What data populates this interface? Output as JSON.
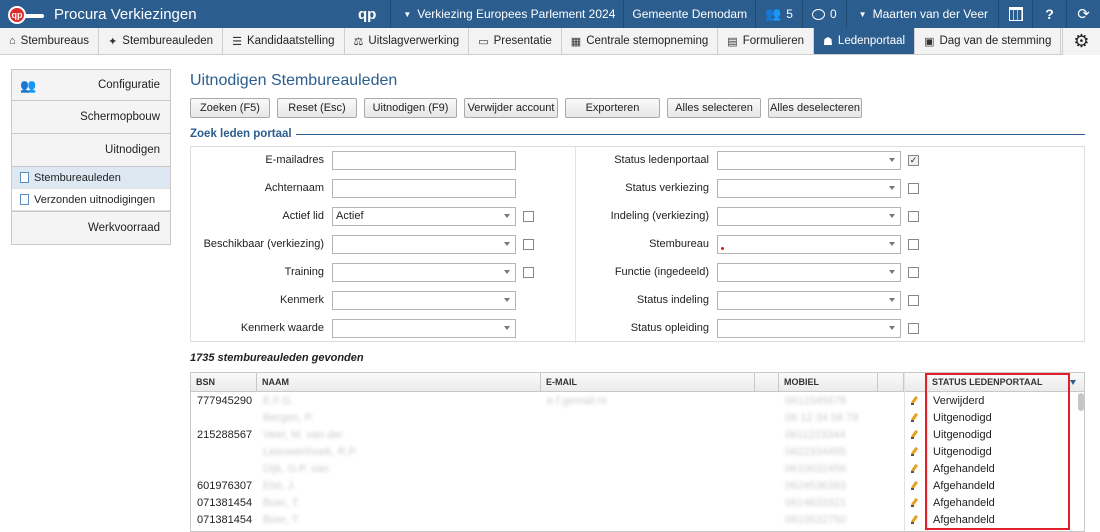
{
  "app": {
    "title": "Procura Verkiezingen",
    "logo_text": "qp",
    "brand_mark": "qp"
  },
  "topbar": {
    "election": "Verkiezing Europees Parlement 2024",
    "municipality": "Gemeente Demodam",
    "users_count": "5",
    "messages_count": "0",
    "user_name": "Maarten van der Veer",
    "help_label": "?"
  },
  "nav": {
    "tabs": [
      {
        "label": "Stembureaus",
        "icon": "home-icon"
      },
      {
        "label": "Stembureauleden",
        "icon": "people-icon"
      },
      {
        "label": "Kandidaatstelling",
        "icon": "list-icon"
      },
      {
        "label": "Uitslagverwerking",
        "icon": "scale-icon"
      },
      {
        "label": "Presentatie",
        "icon": "monitor-icon"
      },
      {
        "label": "Centrale stemopneming",
        "icon": "calculator-icon"
      },
      {
        "label": "Formulieren",
        "icon": "form-icon"
      },
      {
        "label": "Ledenportaal",
        "icon": "group-icon"
      },
      {
        "label": "Dag van de stemming",
        "icon": "ballot-icon"
      }
    ]
  },
  "sidebar": {
    "configuratie": "Configuratie",
    "schermopbouw": "Schermopbouw",
    "uitnodigen": "Uitnodigen",
    "sub_stembureauleden": "Stembureauleden",
    "sub_verzonden": "Verzonden uitnodigingen",
    "werkvoorraad": "Werkvoorraad"
  },
  "main": {
    "title": "Uitnodigen Stembureauleden",
    "buttons": {
      "zoeken": "Zoeken (F5)",
      "reset": "Reset (Esc)",
      "uitnodigen": "Uitnodigen (F9)",
      "verwijder": "Verwijder account",
      "exporteren": "Exporteren",
      "alles_selecteren": "Alles selecteren",
      "alles_deselecteren": "Alles deselecteren"
    },
    "search_title": "Zoek leden portaal",
    "form": {
      "left": [
        {
          "label": "E-mailadres",
          "value": ""
        },
        {
          "label": "Achternaam",
          "value": ""
        },
        {
          "label": "Actief lid",
          "value": "Actief"
        },
        {
          "label": "Beschikbaar (verkiezing)",
          "value": ""
        },
        {
          "label": "Training",
          "value": ""
        },
        {
          "label": "Kenmerk",
          "value": ""
        },
        {
          "label": "Kenmerk waarde",
          "value": ""
        }
      ],
      "right": [
        {
          "label": "Status ledenportaal",
          "value": "",
          "checked": true
        },
        {
          "label": "Status verkiezing",
          "value": "",
          "checked": false
        },
        {
          "label": "Indeling (verkiezing)",
          "value": "",
          "checked": false
        },
        {
          "label": "Stembureau",
          "value": "",
          "checked": false
        },
        {
          "label": "Functie (ingedeeld)",
          "value": "",
          "checked": false
        },
        {
          "label": "Status indeling",
          "value": "",
          "checked": false
        },
        {
          "label": "Status opleiding",
          "value": "",
          "checked": false
        }
      ],
      "check_mark": "✓"
    },
    "results_count": "1735 stembureauleden gevonden",
    "table": {
      "headers": {
        "bsn": "BSN",
        "naam": "NAAM",
        "email": "E-MAIL",
        "mobiel": "MOBIEL",
        "status": "STATUS LEDENPORTAAL"
      },
      "rows": [
        {
          "bsn": "777945290",
          "naam": "E.F.G.",
          "email": "e.f.gemail.nl",
          "mobiel": "0612345678",
          "status": "Verwijderd"
        },
        {
          "bsn": "",
          "naam": "Bergen, P.",
          "email": "",
          "mobiel": "06 12 34 56 78",
          "status": "Uitgenodigd"
        },
        {
          "bsn": "215288567",
          "naam": "Veer, M. van der",
          "email": "",
          "mobiel": "0611223344",
          "status": "Uitgenodigd"
        },
        {
          "bsn": "",
          "naam": "Leeuwenhoek, R.P.",
          "email": "",
          "mobiel": "0622334455",
          "status": "Uitgenodigd"
        },
        {
          "bsn": "",
          "naam": "Dijk, G.P. van",
          "email": "",
          "mobiel": "0610032456",
          "status": "Afgehandeld"
        },
        {
          "bsn": "601976307",
          "naam": "Elst, J.",
          "email": "",
          "mobiel": "0624536383",
          "status": "Afgehandeld"
        },
        {
          "bsn": "071381454",
          "naam": "Boer, T.",
          "email": "",
          "mobiel": "0614633321",
          "status": "Afgehandeld"
        },
        {
          "bsn": "071381454",
          "naam": "Boer, T.",
          "email": "",
          "mobiel": "0610532750",
          "status": "Afgehandeld"
        }
      ]
    }
  }
}
